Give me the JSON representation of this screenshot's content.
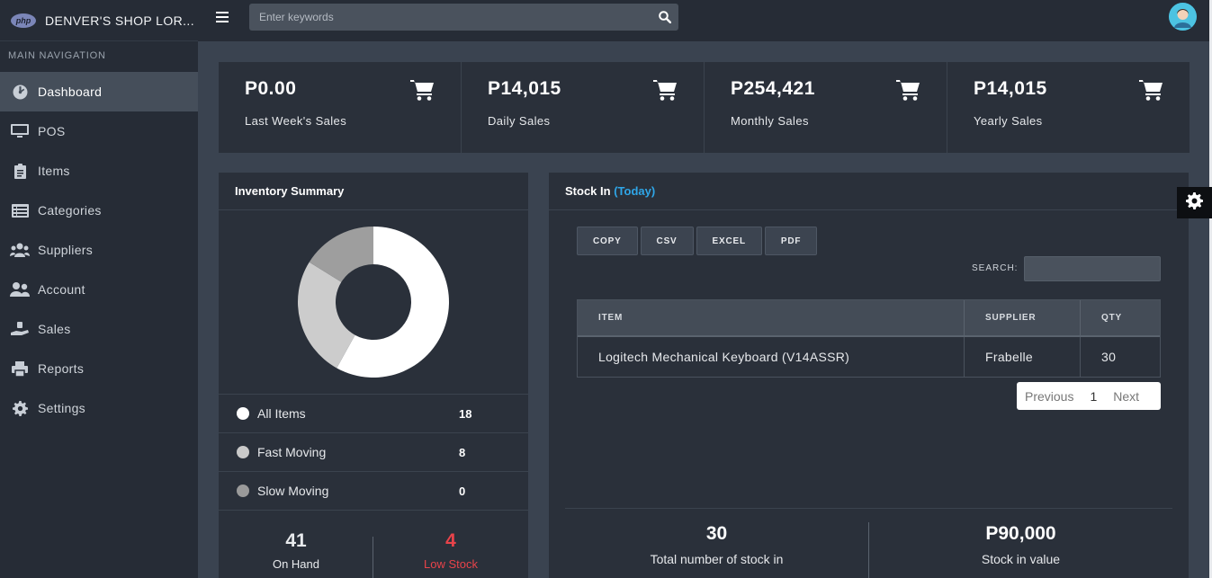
{
  "brand": {
    "logo_text": "php",
    "title": "DENVER'S SHOP LOR..."
  },
  "sidebar": {
    "header": "MAIN NAVIGATION",
    "items": [
      {
        "label": "Dashboard",
        "icon": "dashboard-icon",
        "active": true
      },
      {
        "label": "POS",
        "icon": "desktop-icon"
      },
      {
        "label": "Items",
        "icon": "clipboard-icon"
      },
      {
        "label": "Categories",
        "icon": "list-icon"
      },
      {
        "label": "Suppliers",
        "icon": "users-icon"
      },
      {
        "label": "Account",
        "icon": "user-group-icon"
      },
      {
        "label": "Sales",
        "icon": "sales-hand-icon"
      },
      {
        "label": "Reports",
        "icon": "printer-icon"
      },
      {
        "label": "Settings",
        "icon": "gear-icon"
      }
    ]
  },
  "topbar": {
    "search_placeholder": "Enter keywords"
  },
  "stats": [
    {
      "value": "P0.00",
      "label": "Last Week's Sales"
    },
    {
      "value": "P14,015",
      "label": "Daily Sales"
    },
    {
      "value": "P254,421",
      "label": "Monthly Sales"
    },
    {
      "value": "P14,015",
      "label": "Yearly Sales"
    }
  ],
  "inventory": {
    "title": "Inventory Summary",
    "rows": [
      {
        "label": "All Items",
        "count": "18",
        "color": "#ffffff"
      },
      {
        "label": "Fast Moving",
        "count": "8",
        "color": "#c9c9c9"
      },
      {
        "label": "Slow Moving",
        "count": "0",
        "color": "#9a9a9a"
      }
    ],
    "on_hand": {
      "value": "41",
      "label": "On Hand"
    },
    "low_stock": {
      "value": "4",
      "label": "Low Stock",
      "color": "#e8434a"
    }
  },
  "chart_data": {
    "type": "pie",
    "categories": [
      "All Items",
      "Fast Moving",
      "Slow Moving"
    ],
    "values": [
      18,
      8,
      5
    ],
    "colors": [
      "#ffffff",
      "#cccccc",
      "#9e9e9e"
    ]
  },
  "stock_in": {
    "title": "Stock In",
    "title_accent": "(Today)",
    "buttons": [
      "COPY",
      "CSV",
      "EXCEL",
      "PDF"
    ],
    "search_label": "SEARCH:",
    "columns": [
      "ITEM",
      "SUPPLIER",
      "QTY"
    ],
    "rows": [
      {
        "item": "Logitech Mechanical Keyboard (V14ASSR)",
        "supplier": "Frabelle",
        "qty": "30"
      }
    ],
    "pager": {
      "previous": "Previous",
      "page": "1",
      "next": "Next"
    },
    "total_count": {
      "value": "30",
      "label": "Total number of stock in"
    },
    "total_value": {
      "value": "P90,000",
      "label": "Stock in value"
    }
  }
}
